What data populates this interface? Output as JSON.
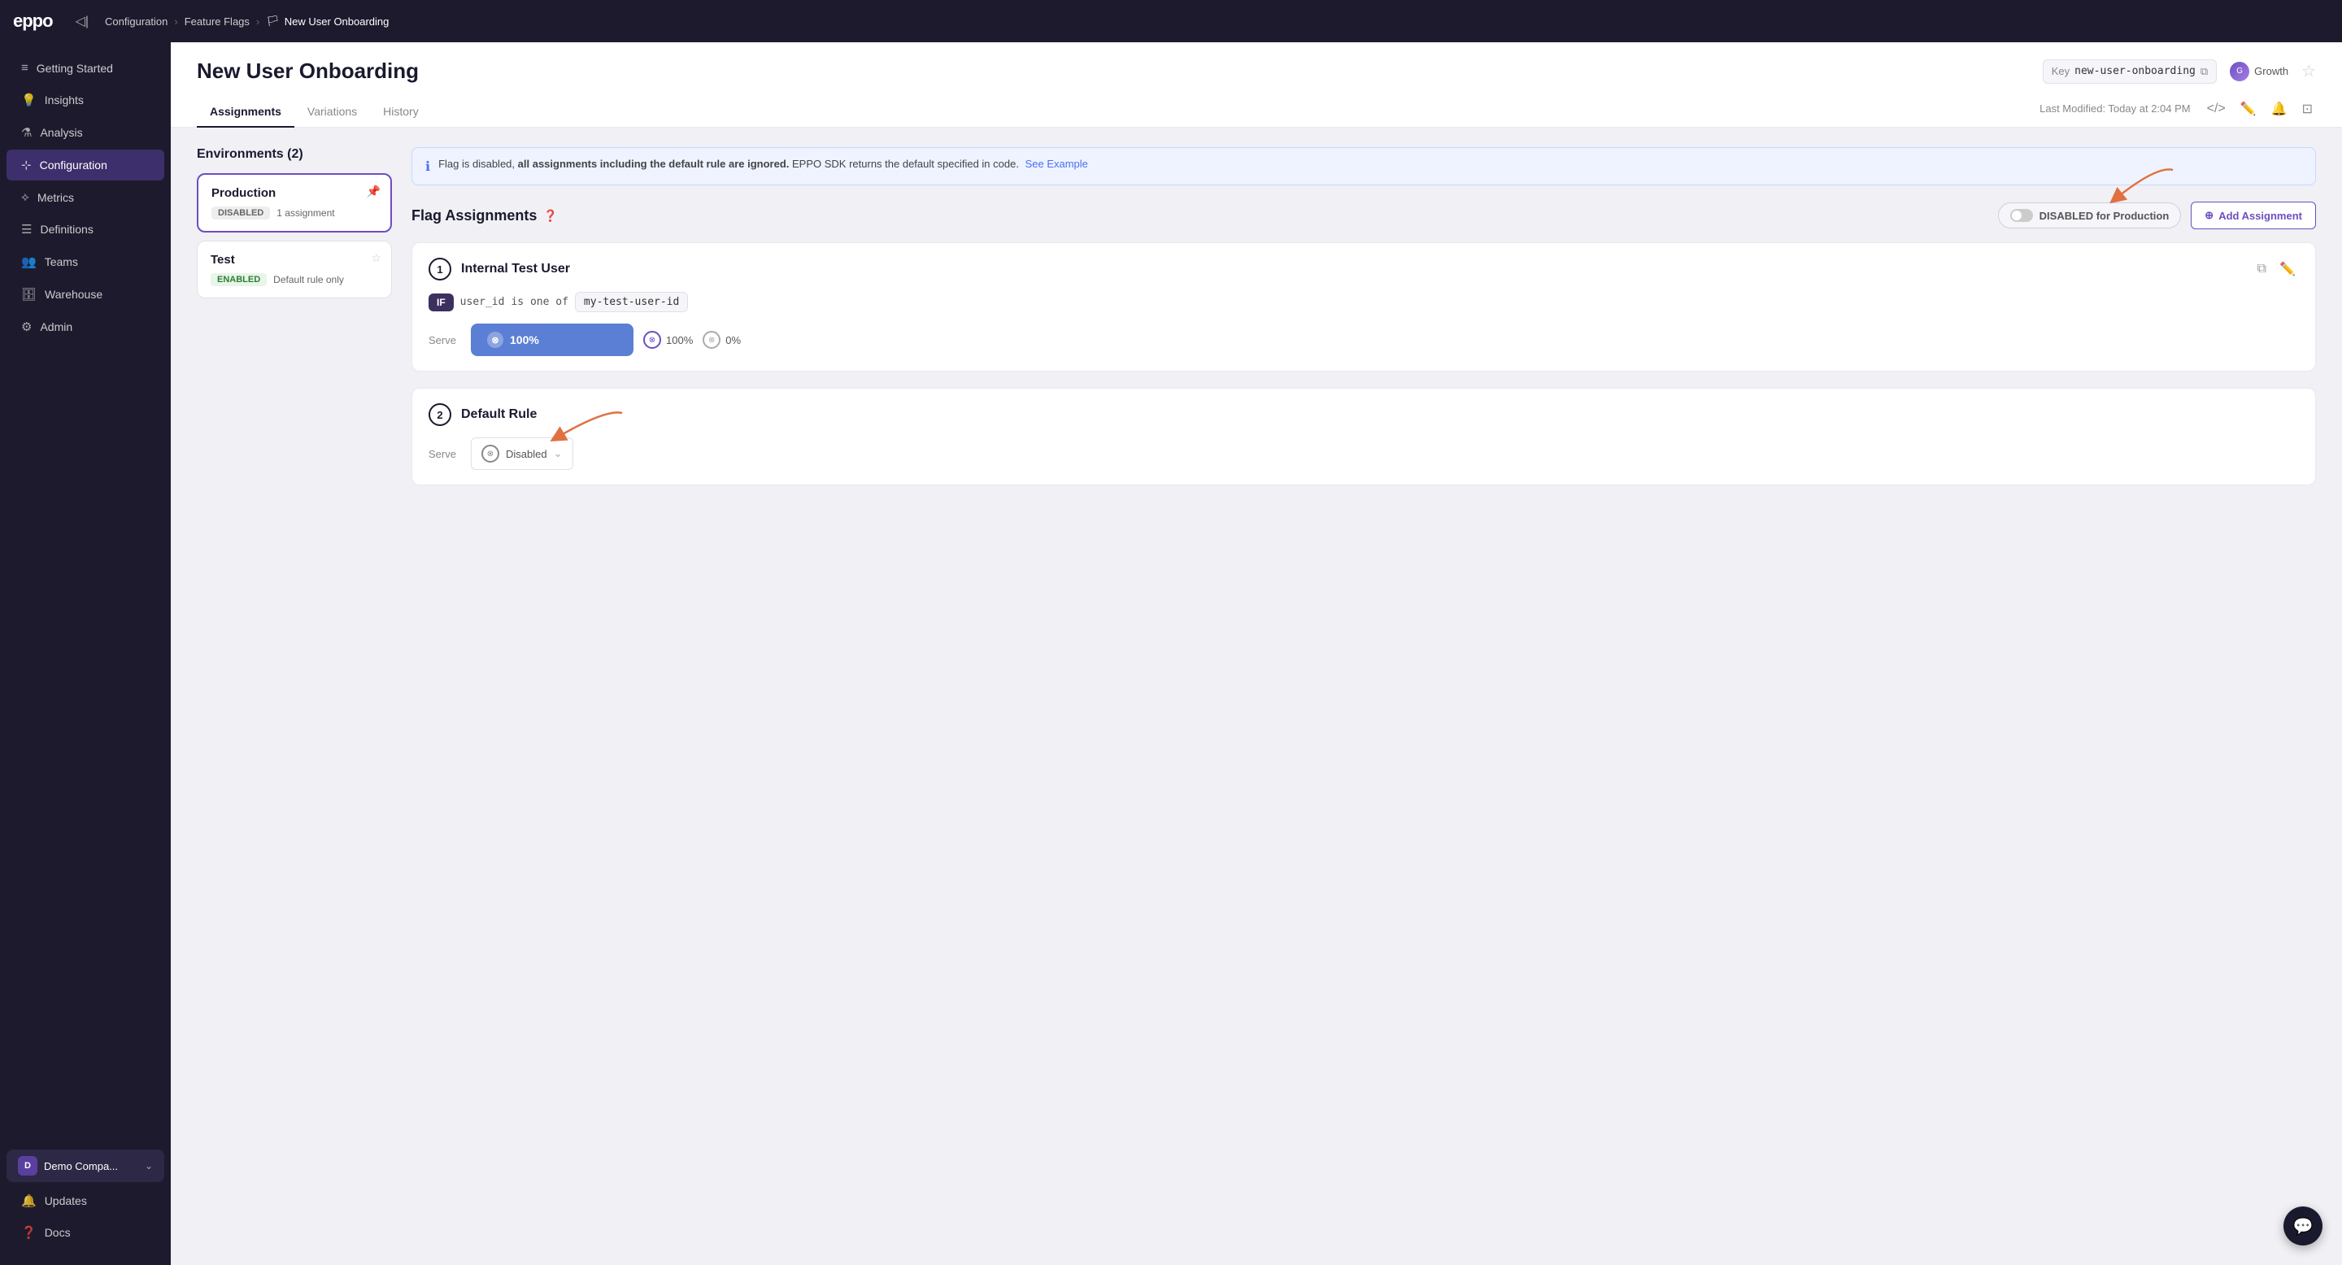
{
  "app": {
    "logo": "eppo",
    "collapse_tooltip": "Collapse sidebar"
  },
  "breadcrumb": {
    "items": [
      "Configuration",
      "Feature Flags"
    ],
    "current": "New User Onboarding",
    "flag_icon": "🏳"
  },
  "sidebar": {
    "items": [
      {
        "id": "getting-started",
        "label": "Getting Started",
        "icon": "≡"
      },
      {
        "id": "insights",
        "label": "Insights",
        "icon": "💡"
      },
      {
        "id": "analysis",
        "label": "Analysis",
        "icon": "⚗"
      },
      {
        "id": "configuration",
        "label": "Configuration",
        "icon": "⊹",
        "active": true
      },
      {
        "id": "metrics",
        "label": "Metrics",
        "icon": "⟡"
      },
      {
        "id": "definitions",
        "label": "Definitions",
        "icon": "☰"
      },
      {
        "id": "teams",
        "label": "Teams",
        "icon": "👥"
      },
      {
        "id": "warehouse",
        "label": "Warehouse",
        "icon": "🗄"
      },
      {
        "id": "admin",
        "label": "Admin",
        "icon": "⚙"
      }
    ],
    "bottom": {
      "company": "Demo Compa...",
      "company_initial": "D",
      "updates": "Updates",
      "docs": "Docs"
    }
  },
  "page": {
    "title": "New User Onboarding",
    "key_label": "Key",
    "key_value": "new-user-onboarding",
    "team": "Growth",
    "last_modified": "Last Modified: Today at 2:04 PM"
  },
  "tabs": {
    "items": [
      "Assignments",
      "Variations",
      "History"
    ],
    "active": "Assignments"
  },
  "environments": {
    "title": "Environments (2)",
    "items": [
      {
        "name": "Production",
        "status": "DISABLED",
        "detail": "1 assignment",
        "selected": true,
        "pinned": true
      },
      {
        "name": "Test",
        "status": "ENABLED",
        "detail": "Default rule only",
        "selected": false,
        "pinned": false
      }
    ]
  },
  "info_banner": {
    "text_pre": "Flag is disabled,",
    "text_bold": "all assignments including the default rule are ignored.",
    "text_post": "EPPO SDK returns the default specified in code.",
    "link_text": "See Example"
  },
  "flag_assignments": {
    "title": "Flag Assignments",
    "toggle_label": "DISABLED for Production",
    "add_button": "Add Assignment",
    "rules": [
      {
        "number": "1",
        "name": "Internal Test User",
        "condition": {
          "field": "user_id",
          "operator": "is one of",
          "value": "my-test-user-id"
        },
        "serve": {
          "bar_label": "100%",
          "items": [
            {
              "label": "100%",
              "type": "purple"
            },
            {
              "label": "0%",
              "type": "gray"
            }
          ]
        }
      }
    ],
    "default_rule": {
      "number": "2",
      "title": "Default Rule",
      "serve_label": "Serve",
      "serve_value": "Disabled"
    }
  },
  "arrows": {
    "toggle_arrow": "← points to DISABLED toggle",
    "default_arrow": "← points to default rule serve"
  }
}
